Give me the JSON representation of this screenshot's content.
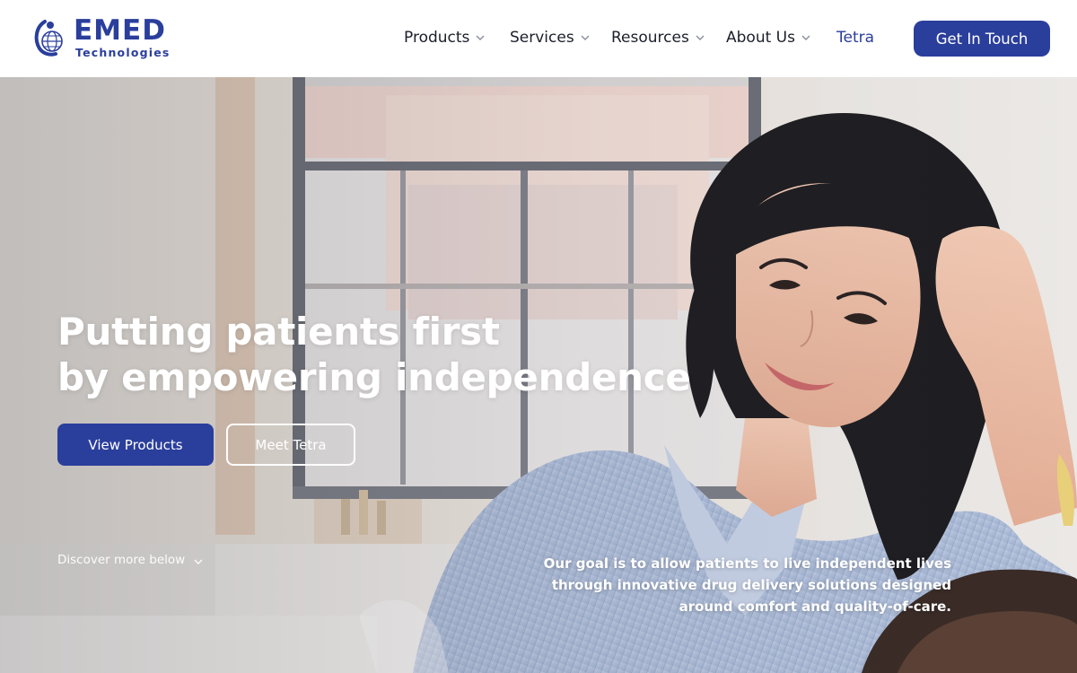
{
  "brand": {
    "name": "EMED",
    "tagline": "Technologies",
    "accent_color": "#2a3e9c"
  },
  "nav": {
    "items": [
      {
        "label": "Products",
        "has_dropdown": true
      },
      {
        "label": "Services",
        "has_dropdown": true
      },
      {
        "label": "Resources",
        "has_dropdown": true
      },
      {
        "label": "About Us",
        "has_dropdown": true
      },
      {
        "label": "Tetra",
        "has_dropdown": false,
        "active": true
      }
    ],
    "cta_label": "Get In Touch"
  },
  "hero": {
    "title_line1": "Putting patients first",
    "title_line2": "by empowering independence",
    "primary_button": "View Products",
    "secondary_button": "Meet Tetra",
    "discover_label": "Discover more below",
    "goal_text": "Our goal is to allow patients to live independent lives through innovative drug delivery solutions designed around comfort and quality-of-care.",
    "image_subject": "smiling woman in striped blue shirt"
  },
  "icons": {
    "chevron": "chevron-down-icon",
    "logo": "globe-logo-icon"
  }
}
